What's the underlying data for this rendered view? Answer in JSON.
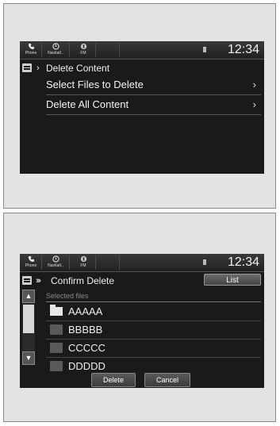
{
  "screen1": {
    "topbar": {
      "phone": "Phone",
      "navi": "NaviIatI..",
      "fm": "FM",
      "clock": "12:34"
    },
    "title": "Delete Content",
    "menu": [
      {
        "label": "Select Files to Delete",
        "chevron": "›"
      },
      {
        "label": "Delete All Content",
        "chevron": "›"
      }
    ]
  },
  "screen2": {
    "topbar": {
      "phone": "Phone",
      "navi": "NaviIatI..",
      "fm": "FM",
      "clock": "12:34"
    },
    "title": "Confirm Delete",
    "list_button": "List",
    "selected_label": "Selected files",
    "files": [
      "AAAAA",
      "BBBBB",
      "CCCCC",
      "DDDDD"
    ],
    "delete_button": "Delete",
    "cancel_button": "Cancel"
  }
}
